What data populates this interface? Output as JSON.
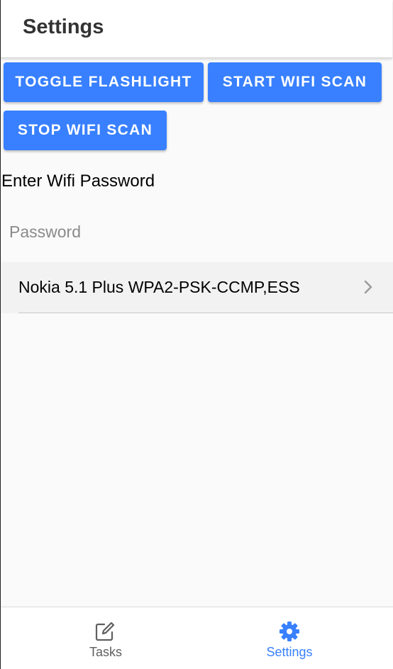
{
  "header": {
    "title": "Settings"
  },
  "buttons": {
    "toggle_flashlight": "TOGGLE FLASHLIGHT",
    "start_wifi_scan": "START WIFI SCAN",
    "stop_wifi_scan": "STOP WIFI SCAN"
  },
  "form": {
    "password_label": "Enter Wifi Password",
    "password_placeholder": "Password",
    "password_value": ""
  },
  "networks": [
    {
      "label": "Nokia 5.1 Plus WPA2-PSK-CCMP,ESS",
      "icon": "chevron-right-icon"
    }
  ],
  "tabs": [
    {
      "label": "Tasks",
      "icon": "edit-icon",
      "active": false
    },
    {
      "label": "Settings",
      "icon": "gear-icon",
      "active": true
    }
  ],
  "colors": {
    "accent": "#3880ff",
    "tab_inactive": "#5f5f5f",
    "tab_active": "#3880ff",
    "title": "#333333"
  }
}
